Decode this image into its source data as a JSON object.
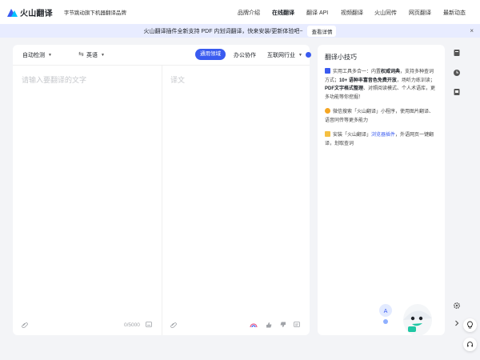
{
  "header": {
    "logo_text": "火山翻译",
    "slogan": "字节跳动旗下机器翻译品牌",
    "nav": [
      {
        "label": "品牌介绍"
      },
      {
        "label": "在线翻译"
      },
      {
        "label": "翻译 API"
      },
      {
        "label": "视频翻译"
      },
      {
        "label": "火山同传"
      },
      {
        "label": "网页翻译"
      },
      {
        "label": "最新动态"
      }
    ]
  },
  "banner": {
    "text": "火山翻译插件全新支持 PDF 内划词翻译，快来安装/更新体验吧~",
    "button": "查看详情",
    "close": "×"
  },
  "toolbar": {
    "source_lang": "自动检测",
    "swap": "⇆",
    "target_lang": "英语",
    "domains": [
      "通用领域",
      "办公协作",
      "互联网行业"
    ]
  },
  "editor": {
    "source_placeholder": "请输入要翻译的文字",
    "target_placeholder": "译文",
    "counter": "0/5000"
  },
  "tips": {
    "title": "翻译小技巧",
    "items": [
      {
        "icon_color": "#3a5bf0",
        "text_pre": "实用工具多合一：内置",
        "bold1": "权威词典",
        "text_mid": "，支持多种查词方式；",
        "bold2": "10+ 语种丰富音色免费开放",
        "text_mid2": "，场听力练训读；",
        "bold3": "PDF文字格式整理",
        "text_post": "、对照阅读模式、个人术语库，更多功能等你挖掘！"
      },
      {
        "icon_color": "#f5a623",
        "text": "微信搜索「火山翻译」小程序，使用图片翻译、语音同传等更多能力"
      },
      {
        "icon_color": "#f5c042",
        "text_pre": "安装「火山翻译」",
        "link": "浏览器插件",
        "text_post": "，外语网页一键翻译，划取查词"
      }
    ]
  }
}
